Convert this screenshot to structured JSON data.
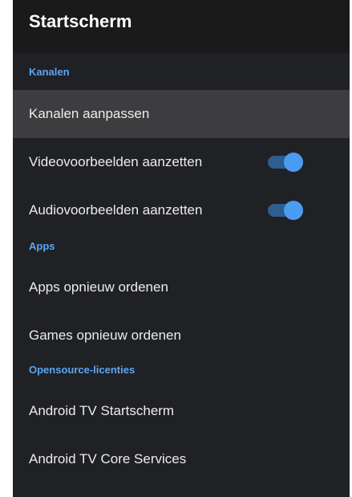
{
  "header": {
    "title": "Startscherm"
  },
  "sections": {
    "kanalen": {
      "label": "Kanalen",
      "items": {
        "customize": {
          "label": "Kanalen aanpassen"
        },
        "video_previews": {
          "label": "Videovoorbeelden aanzetten",
          "enabled": true
        },
        "audio_previews": {
          "label": "Audiovoorbeelden aanzetten",
          "enabled": true
        }
      }
    },
    "apps": {
      "label": "Apps",
      "items": {
        "reorder_apps": {
          "label": "Apps opnieuw ordenen"
        },
        "reorder_games": {
          "label": "Games opnieuw ordenen"
        }
      }
    },
    "opensource": {
      "label": "Opensource-licenties",
      "items": {
        "tv_home": {
          "label": "Android TV Startscherm"
        },
        "tv_core": {
          "label": "Android TV Core Services"
        }
      }
    }
  },
  "colors": {
    "panel_background": "#202124",
    "header_background": "#1a1a1b",
    "section_accent": "#5ca5f5",
    "focused_item": "#3d3d3f",
    "toggle_thumb": "#4a9cf2",
    "toggle_track": "#2e5d8f"
  }
}
